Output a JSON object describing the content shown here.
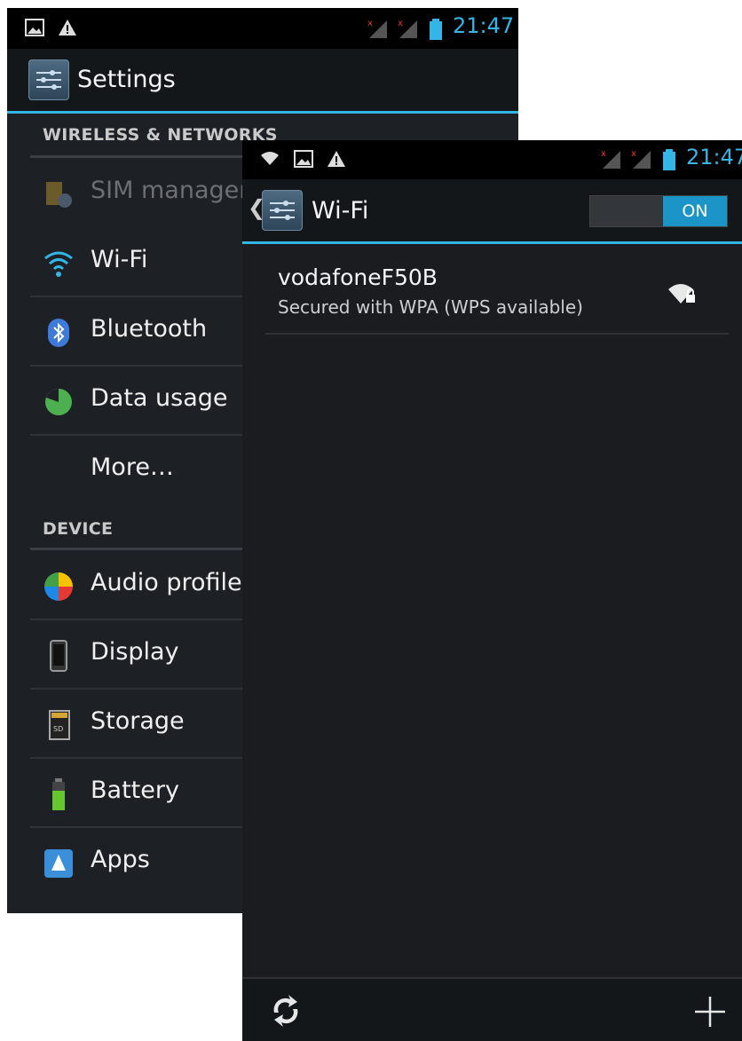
{
  "settings": {
    "status_time": "21:47",
    "title": "Settings",
    "sections": [
      {
        "header": "WIRELESS & NETWORKS",
        "items": [
          {
            "label": "SIM management",
            "icon": "sim-icon",
            "disabled": true
          },
          {
            "label": "Wi-Fi",
            "icon": "wifi-icon"
          },
          {
            "label": "Bluetooth",
            "icon": "bluetooth-icon"
          },
          {
            "label": "Data usage",
            "icon": "data-usage-icon"
          },
          {
            "label": "More…",
            "icon": ""
          }
        ]
      },
      {
        "header": "DEVICE",
        "items": [
          {
            "label": "Audio profiles",
            "icon": "audio-profiles-icon"
          },
          {
            "label": "Display",
            "icon": "display-icon"
          },
          {
            "label": "Storage",
            "icon": "storage-icon"
          },
          {
            "label": "Battery",
            "icon": "battery-icon"
          },
          {
            "label": "Apps",
            "icon": "apps-icon"
          }
        ]
      }
    ]
  },
  "wifi": {
    "status_time": "21:47",
    "back_glyph": "❮",
    "title": "Wi-Fi",
    "toggle_label": "ON",
    "network": {
      "ssid": "vodafoneF50B",
      "security": "Secured with WPA (WPS available)"
    },
    "bottom_actions": [
      {
        "icon": "wps-icon"
      },
      {
        "icon": "add-network-icon"
      }
    ]
  },
  "colors": {
    "accent": "#33b5e5",
    "background": "#1d2024"
  }
}
